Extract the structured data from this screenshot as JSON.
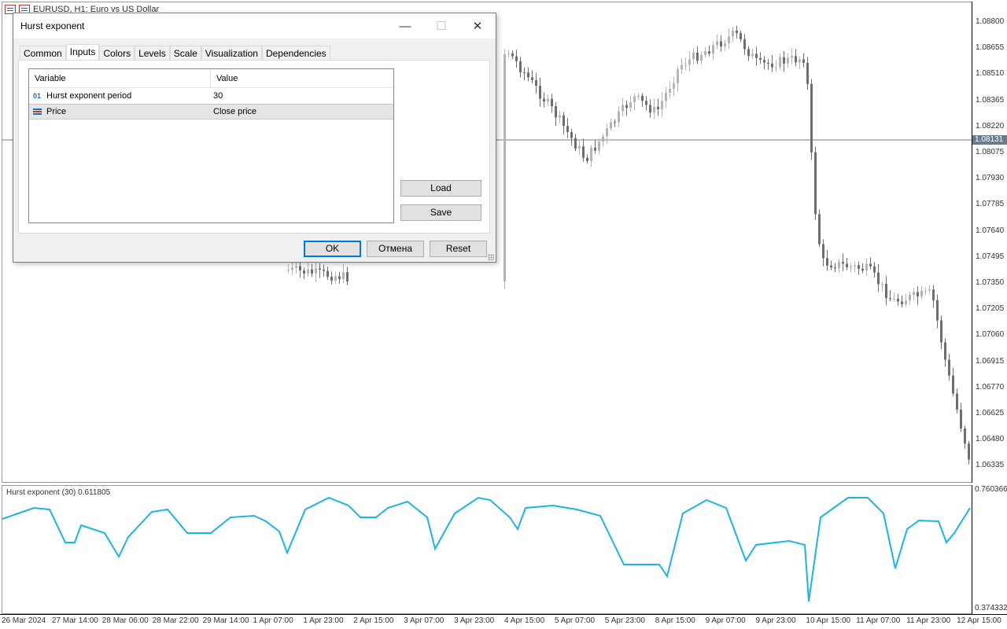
{
  "chart": {
    "symbol_title": "EURUSD, H1:  Euro vs US Dollar",
    "current_price": "1.08131",
    "price_axis": [
      "1.08800",
      "1.08655",
      "1.08510",
      "1.08365",
      "1.08220",
      "1.08075",
      "1.07930",
      "1.07785",
      "1.07640",
      "1.07495",
      "1.07350",
      "1.07205",
      "1.07060",
      "1.06915",
      "1.06770",
      "1.06625",
      "1.06480",
      "1.06335"
    ],
    "time_axis": [
      "26 Mar 2024",
      "27 Mar 14:00",
      "28 Mar 06:00",
      "28 Mar 22:00",
      "29 Mar 14:00",
      "1 Apr 07:00",
      "1 Apr 23:00",
      "2 Apr 15:00",
      "3 Apr 07:00",
      "3 Apr 23:00",
      "4 Apr 15:00",
      "5 Apr 07:00",
      "5 Apr 23:00",
      "8 Apr 15:00",
      "9 Apr 07:00",
      "9 Apr 23:00",
      "10 Apr 15:00",
      "11 Apr 07:00",
      "11 Apr 23:00",
      "12 Apr 15:00"
    ],
    "colors": {
      "bull_candle": "#b4b4b4",
      "bear_candle": "#6e6e6e",
      "indicator_line": "#1ab4e6",
      "price_tag": "#6b7b8c"
    }
  },
  "indicator": {
    "title": "Hurst exponent (30) 0.611805",
    "axis_max": "0.760366",
    "axis_min": "0.374332"
  },
  "dialog": {
    "title": "Hurst exponent",
    "tabs": [
      "Common",
      "Inputs",
      "Colors",
      "Levels",
      "Scale",
      "Visualization",
      "Dependencies"
    ],
    "active_tab": "Inputs",
    "table": {
      "headers": [
        "Variable",
        "Value"
      ],
      "rows": [
        {
          "icon": "01",
          "variable": "Hurst exponent period",
          "value": "30"
        },
        {
          "icon": "list-icon",
          "variable": "Price",
          "value": "Close price"
        }
      ]
    },
    "side_buttons": {
      "load": "Load",
      "save": "Save"
    },
    "footer_buttons": {
      "ok": "OK",
      "cancel": "Отмена",
      "reset": "Reset"
    }
  }
}
